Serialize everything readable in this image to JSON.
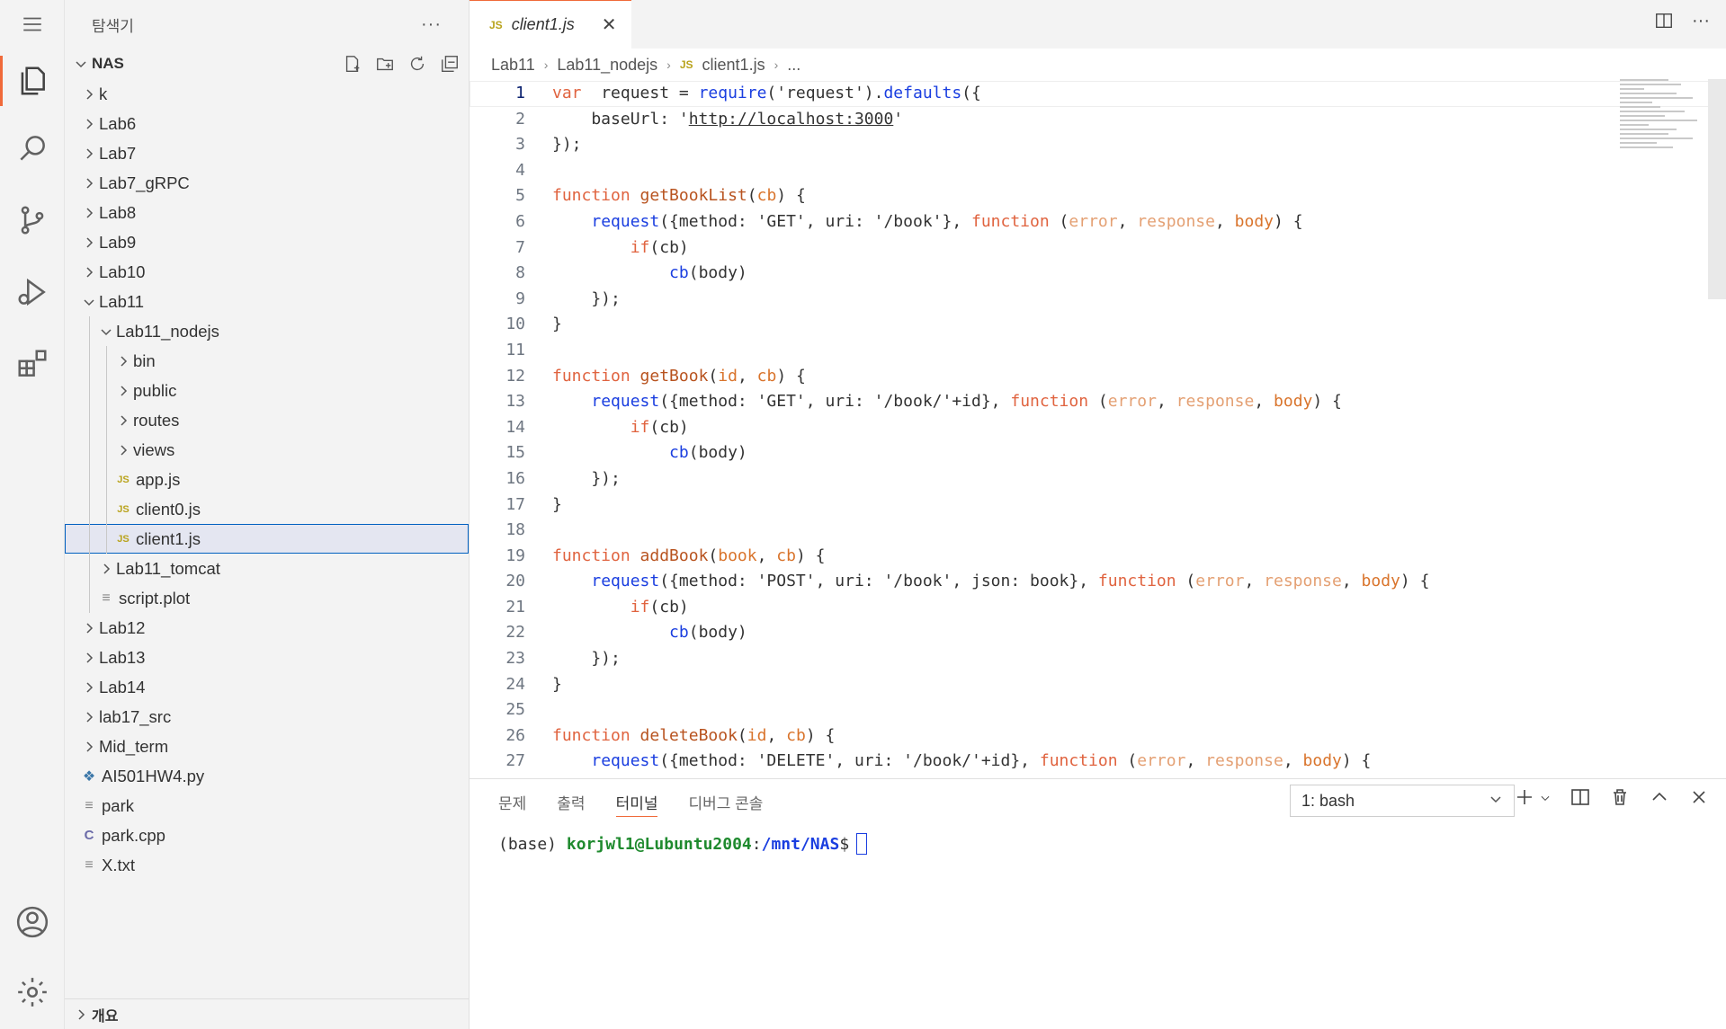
{
  "sidebar": {
    "title": "탐색기",
    "more": "···",
    "section": "NAS",
    "footer": "개요",
    "items": [
      {
        "label": "k",
        "type": "folder",
        "open": false,
        "depth": 0
      },
      {
        "label": "Lab6",
        "type": "folder",
        "open": false,
        "depth": 0
      },
      {
        "label": "Lab7",
        "type": "folder",
        "open": false,
        "depth": 0
      },
      {
        "label": "Lab7_gRPC",
        "type": "folder",
        "open": false,
        "depth": 0
      },
      {
        "label": "Lab8",
        "type": "folder",
        "open": false,
        "depth": 0
      },
      {
        "label": "Lab9",
        "type": "folder",
        "open": false,
        "depth": 0
      },
      {
        "label": "Lab10",
        "type": "folder",
        "open": false,
        "depth": 0
      },
      {
        "label": "Lab11",
        "type": "folder",
        "open": true,
        "depth": 0
      },
      {
        "label": "Lab11_nodejs",
        "type": "folder",
        "open": true,
        "depth": 1
      },
      {
        "label": "bin",
        "type": "folder",
        "open": false,
        "depth": 2
      },
      {
        "label": "public",
        "type": "folder",
        "open": false,
        "depth": 2
      },
      {
        "label": "routes",
        "type": "folder",
        "open": false,
        "depth": 2
      },
      {
        "label": "views",
        "type": "folder",
        "open": false,
        "depth": 2
      },
      {
        "label": "app.js",
        "type": "js",
        "depth": 2
      },
      {
        "label": "client0.js",
        "type": "js",
        "depth": 2
      },
      {
        "label": "client1.js",
        "type": "js",
        "depth": 2,
        "selected": true
      },
      {
        "label": "Lab11_tomcat",
        "type": "folder",
        "open": false,
        "depth": 1
      },
      {
        "label": "script.plot",
        "type": "txt",
        "depth": 1
      },
      {
        "label": "Lab12",
        "type": "folder",
        "open": false,
        "depth": 0
      },
      {
        "label": "Lab13",
        "type": "folder",
        "open": false,
        "depth": 0
      },
      {
        "label": "Lab14",
        "type": "folder",
        "open": false,
        "depth": 0
      },
      {
        "label": "lab17_src",
        "type": "folder",
        "open": false,
        "depth": 0
      },
      {
        "label": "Mid_term",
        "type": "folder",
        "open": false,
        "depth": 0
      },
      {
        "label": "AI501HW4.py",
        "type": "py",
        "depth": 0
      },
      {
        "label": "park",
        "type": "txt",
        "depth": 0
      },
      {
        "label": "park.cpp",
        "type": "cpp",
        "depth": 0
      },
      {
        "label": "X.txt",
        "type": "txt",
        "depth": 0
      }
    ]
  },
  "editor": {
    "tab": {
      "icon": "JS",
      "label": "client1.js"
    },
    "breadcrumb": [
      "Lab11",
      "Lab11_nodejs",
      "client1.js",
      "..."
    ],
    "current_line": 1,
    "lines": [
      [
        [
          "kw",
          "var"
        ],
        [
          "",
          "  request = "
        ],
        [
          "blue",
          "require"
        ],
        [
          "",
          "('request')."
        ],
        [
          "blue",
          "defaults"
        ],
        [
          "",
          "({"
        ]
      ],
      [
        [
          "",
          "    baseUrl: '"
        ],
        [
          "url",
          "http://localhost:3000"
        ],
        [
          "",
          "'"
        ]
      ],
      [
        [
          "",
          "});"
        ]
      ],
      [],
      [
        [
          "kw",
          "function"
        ],
        [
          "",
          " "
        ],
        [
          "fn",
          "getBookList"
        ],
        [
          "",
          "("
        ],
        [
          "prm2",
          "cb"
        ],
        [
          "",
          ") {"
        ]
      ],
      [
        [
          "",
          "    "
        ],
        [
          "blue",
          "request"
        ],
        [
          "",
          "({method: 'GET', uri: '/book'}, "
        ],
        [
          "kw",
          "function"
        ],
        [
          "",
          " ("
        ],
        [
          "prm",
          "error"
        ],
        [
          "",
          ", "
        ],
        [
          "prm",
          "response"
        ],
        [
          "",
          ", "
        ],
        [
          "prm2",
          "body"
        ],
        [
          "",
          ") {"
        ]
      ],
      [
        [
          "",
          "        "
        ],
        [
          "kw",
          "if"
        ],
        [
          "",
          "(cb)"
        ]
      ],
      [
        [
          "",
          "            "
        ],
        [
          "blue",
          "cb"
        ],
        [
          "",
          "(body)"
        ]
      ],
      [
        [
          "",
          "    });"
        ]
      ],
      [
        [
          "",
          "}"
        ]
      ],
      [],
      [
        [
          "kw",
          "function"
        ],
        [
          "",
          " "
        ],
        [
          "fn",
          "getBook"
        ],
        [
          "",
          "("
        ],
        [
          "prm2",
          "id"
        ],
        [
          "",
          ", "
        ],
        [
          "prm2",
          "cb"
        ],
        [
          "",
          ") {"
        ]
      ],
      [
        [
          "",
          "    "
        ],
        [
          "blue",
          "request"
        ],
        [
          "",
          "({method: 'GET', uri: '/book/'+id}, "
        ],
        [
          "kw",
          "function"
        ],
        [
          "",
          " ("
        ],
        [
          "prm",
          "error"
        ],
        [
          "",
          ", "
        ],
        [
          "prm",
          "response"
        ],
        [
          "",
          ", "
        ],
        [
          "prm2",
          "body"
        ],
        [
          "",
          ") {"
        ]
      ],
      [
        [
          "",
          "        "
        ],
        [
          "kw",
          "if"
        ],
        [
          "",
          "(cb)"
        ]
      ],
      [
        [
          "",
          "            "
        ],
        [
          "blue",
          "cb"
        ],
        [
          "",
          "(body)"
        ]
      ],
      [
        [
          "",
          "    });"
        ]
      ],
      [
        [
          "",
          "}"
        ]
      ],
      [],
      [
        [
          "kw",
          "function"
        ],
        [
          "",
          " "
        ],
        [
          "fn",
          "addBook"
        ],
        [
          "",
          "("
        ],
        [
          "prm2",
          "book"
        ],
        [
          "",
          ", "
        ],
        [
          "prm2",
          "cb"
        ],
        [
          "",
          ") {"
        ]
      ],
      [
        [
          "",
          "    "
        ],
        [
          "blue",
          "request"
        ],
        [
          "",
          "({method: 'POST', uri: '/book', json: book}, "
        ],
        [
          "kw",
          "function"
        ],
        [
          "",
          " ("
        ],
        [
          "prm",
          "error"
        ],
        [
          "",
          ", "
        ],
        [
          "prm",
          "response"
        ],
        [
          "",
          ", "
        ],
        [
          "prm2",
          "body"
        ],
        [
          "",
          ") {"
        ]
      ],
      [
        [
          "",
          "        "
        ],
        [
          "kw",
          "if"
        ],
        [
          "",
          "(cb)"
        ]
      ],
      [
        [
          "",
          "            "
        ],
        [
          "blue",
          "cb"
        ],
        [
          "",
          "(body)"
        ]
      ],
      [
        [
          "",
          "    });"
        ]
      ],
      [
        [
          "",
          "}"
        ]
      ],
      [],
      [
        [
          "kw",
          "function"
        ],
        [
          "",
          " "
        ],
        [
          "fn",
          "deleteBook"
        ],
        [
          "",
          "("
        ],
        [
          "prm2",
          "id"
        ],
        [
          "",
          ", "
        ],
        [
          "prm2",
          "cb"
        ],
        [
          "",
          ") {"
        ]
      ],
      [
        [
          "",
          "    "
        ],
        [
          "blue",
          "request"
        ],
        [
          "",
          "({method: 'DELETE', uri: '/book/'+id}, "
        ],
        [
          "kw",
          "function"
        ],
        [
          "",
          " ("
        ],
        [
          "prm",
          "error"
        ],
        [
          "",
          ", "
        ],
        [
          "prm",
          "response"
        ],
        [
          "",
          ", "
        ],
        [
          "prm2",
          "body"
        ],
        [
          "",
          ") {"
        ]
      ]
    ]
  },
  "panel": {
    "tabs": [
      "문제",
      "출력",
      "터미널",
      "디버그 콘솔"
    ],
    "active_tab": 2,
    "terminal_select": "1: bash",
    "prompt": {
      "env": "(base) ",
      "user": "korjwl1@Lubuntu2004",
      "sep": ":",
      "path": "/mnt/NAS",
      "end": "$"
    }
  },
  "colors": {
    "accent": "#f06a3a",
    "keyword": "#e0633f",
    "selection": "#0060c0"
  }
}
